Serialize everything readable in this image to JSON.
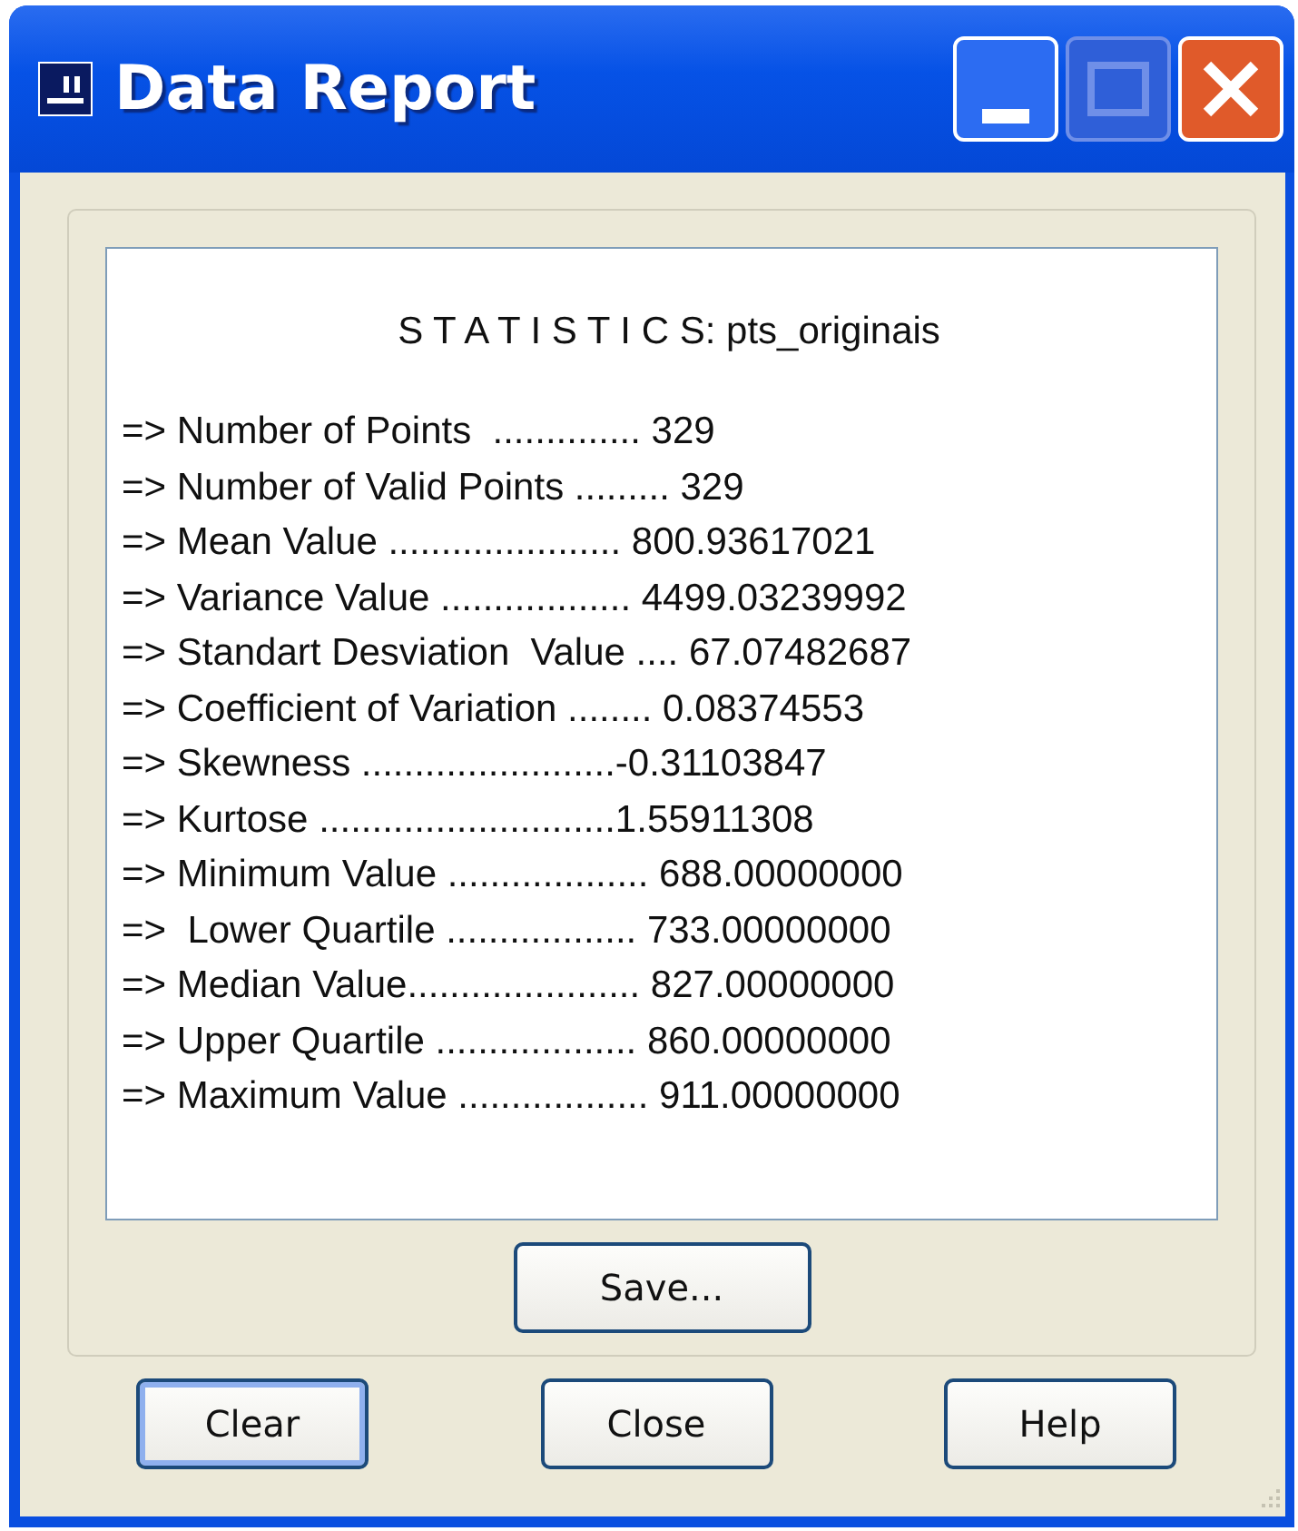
{
  "window": {
    "title": "Data Report"
  },
  "report": {
    "heading": "S T A T I S T I C S: pts_originais",
    "lines": [
      "=> Number of Points  .............. 329",
      "=> Number of Valid Points ......... 329",
      "=> Mean Value ...................... 800.93617021",
      "=> Variance Value .................. 4499.03239992",
      "=> Standart Desviation  Value .... 67.07482687",
      "=> Coefficient of Variation ........ 0.08374553",
      "=> Skewness ........................-0.31103847",
      "=> Kurtose ............................1.55911308",
      "=> Minimum Value ................... 688.00000000",
      "=>  Lower Quartile .................. 733.00000000",
      "=> Median Value...................... 827.00000000",
      "=> Upper Quartile ................... 860.00000000",
      "=> Maximum Value .................. 911.00000000"
    ]
  },
  "save_button": "Save...",
  "buttons": [
    {
      "label": "Clear",
      "default": true
    },
    {
      "label": "Close",
      "default": false
    },
    {
      "label": "Help",
      "default": false
    }
  ]
}
